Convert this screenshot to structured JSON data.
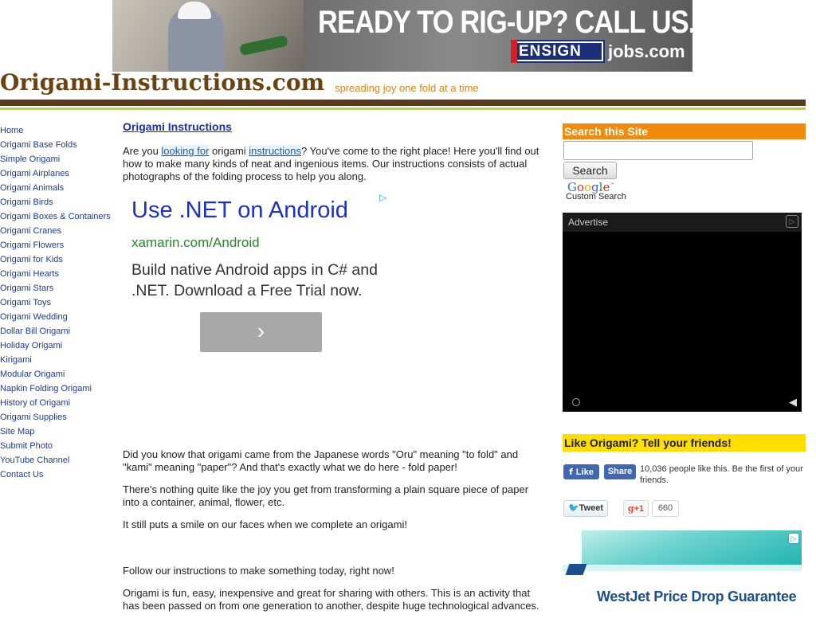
{
  "top_banner": {
    "headline": "READY TO RIG-UP? CALL US.",
    "logo_text": "ENSIGN",
    "logo_suffix": "jobs.com"
  },
  "header": {
    "site_title": "Origami-Instructions.com",
    "tagline": "spreading joy one fold at a time"
  },
  "left_nav": {
    "items": [
      "Home",
      "Origami Base Folds",
      "Simple Origami",
      "Origami Airplanes",
      "Origami Animals",
      "Origami Birds",
      "Origami Boxes & Containers",
      "Origami Cranes",
      "Origami Flowers",
      "Origami for Kids",
      "Origami Hearts",
      "Origami Stars",
      "Origami Toys",
      "Origami Wedding",
      "Dollar Bill Origami",
      "Holiday Origami",
      "Kirigami",
      "Modular Origami",
      "Napkin Folding Origami",
      "History of Origami",
      "Origami Supplies",
      "Site Map",
      "Submit Photo",
      "YouTube Channel",
      "Contact Us"
    ]
  },
  "main": {
    "title": "Origami Instructions",
    "intro_prefix": "Are you ",
    "intro_link1": "looking for",
    "intro_mid1": " origami ",
    "intro_link2": "instructions",
    "intro_rest": "?  You've come to the right place!  Here you'll find out how to make many kinds of neat and ingenious items. Our instructions consists of actual photographs of the folding process to help you along.",
    "paragraphs": [
      "Did you know that origami came from the Japanese words \"Oru\" meaning \"to fold\" and \"kami\" meaning \"paper\"? And that's exactly what we do here - fold paper!",
      "There's nothing quite like the joy you get from transforming a plain square piece of paper into a container, animal, flower, etc.",
      "It still puts a smile on our faces when we complete an origami!",
      "Follow our instructions to make something today, right now!",
      "Origami is fun, easy, inexpensive and great for sharing with others.  This is an activity that has been passed on from one generation to another, despite huge technological advances."
    ]
  },
  "content_ad": {
    "headline": "Use .NET on Android",
    "url": "xamarin.com/Android",
    "description": "Build native Android apps in C# and .NET. Download a Free Trial now.",
    "button_glyph": "›"
  },
  "search": {
    "heading": "Search this Site",
    "input_value": "",
    "button_label": "Search",
    "custom_search_label": "Custom Search"
  },
  "video_ad": {
    "label": "Advertise"
  },
  "social": {
    "heading": "Like Origami? Tell your friends!",
    "like_label": "Like",
    "share_label": "Share",
    "like_text": "10,036 people like this. Be the first of your friends.",
    "tweet_label": "Tweet",
    "gplus_label": "+1",
    "gplus_count": "660"
  },
  "westjet_ad": {
    "text": "WestJet Price Drop Guarantee"
  },
  "colors": {
    "title_brown": "#6b4312",
    "tagline_orange": "#e8820c",
    "header_bar": "#5a3a1e",
    "accent_lime": "#b7d63a",
    "search_header": "#f28a0e",
    "social_header": "#ffde00",
    "link_blue": "#1a3a9a"
  }
}
